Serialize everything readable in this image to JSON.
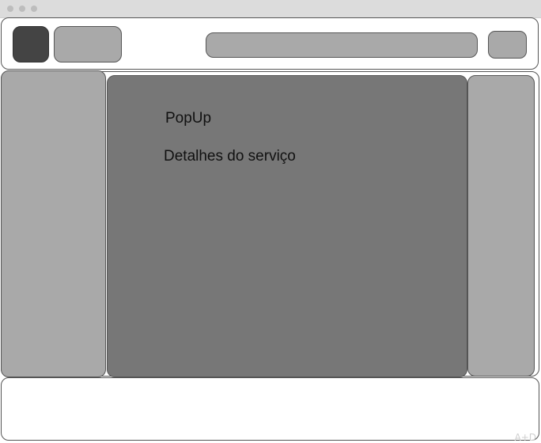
{
  "popup": {
    "title": "PopUp",
    "subtitle": "Detalhes do serviço"
  },
  "colors": {
    "logo": "#444444",
    "panel": "#a9a9a9",
    "popup_background": "#777777",
    "titlebar": "#dcdcdc"
  },
  "icons": {
    "window_controls": [
      "window-dot-icon",
      "window-dot-icon",
      "window-dot-icon"
    ]
  },
  "watermark": "A+D"
}
